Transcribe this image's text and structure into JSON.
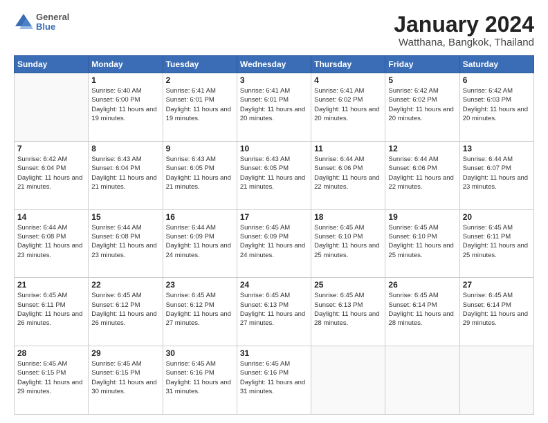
{
  "logo": {
    "general": "General",
    "blue": "Blue"
  },
  "title": "January 2024",
  "subtitle": "Watthana, Bangkok, Thailand",
  "days_of_week": [
    "Sunday",
    "Monday",
    "Tuesday",
    "Wednesday",
    "Thursday",
    "Friday",
    "Saturday"
  ],
  "weeks": [
    [
      {
        "day": "",
        "sunrise": "",
        "sunset": "",
        "daylight": "",
        "empty": true
      },
      {
        "day": "1",
        "sunrise": "Sunrise: 6:40 AM",
        "sunset": "Sunset: 6:00 PM",
        "daylight": "Daylight: 11 hours and 19 minutes."
      },
      {
        "day": "2",
        "sunrise": "Sunrise: 6:41 AM",
        "sunset": "Sunset: 6:01 PM",
        "daylight": "Daylight: 11 hours and 19 minutes."
      },
      {
        "day": "3",
        "sunrise": "Sunrise: 6:41 AM",
        "sunset": "Sunset: 6:01 PM",
        "daylight": "Daylight: 11 hours and 20 minutes."
      },
      {
        "day": "4",
        "sunrise": "Sunrise: 6:41 AM",
        "sunset": "Sunset: 6:02 PM",
        "daylight": "Daylight: 11 hours and 20 minutes."
      },
      {
        "day": "5",
        "sunrise": "Sunrise: 6:42 AM",
        "sunset": "Sunset: 6:02 PM",
        "daylight": "Daylight: 11 hours and 20 minutes."
      },
      {
        "day": "6",
        "sunrise": "Sunrise: 6:42 AM",
        "sunset": "Sunset: 6:03 PM",
        "daylight": "Daylight: 11 hours and 20 minutes."
      }
    ],
    [
      {
        "day": "7",
        "sunrise": "Sunrise: 6:42 AM",
        "sunset": "Sunset: 6:04 PM",
        "daylight": "Daylight: 11 hours and 21 minutes."
      },
      {
        "day": "8",
        "sunrise": "Sunrise: 6:43 AM",
        "sunset": "Sunset: 6:04 PM",
        "daylight": "Daylight: 11 hours and 21 minutes."
      },
      {
        "day": "9",
        "sunrise": "Sunrise: 6:43 AM",
        "sunset": "Sunset: 6:05 PM",
        "daylight": "Daylight: 11 hours and 21 minutes."
      },
      {
        "day": "10",
        "sunrise": "Sunrise: 6:43 AM",
        "sunset": "Sunset: 6:05 PM",
        "daylight": "Daylight: 11 hours and 21 minutes."
      },
      {
        "day": "11",
        "sunrise": "Sunrise: 6:44 AM",
        "sunset": "Sunset: 6:06 PM",
        "daylight": "Daylight: 11 hours and 22 minutes."
      },
      {
        "day": "12",
        "sunrise": "Sunrise: 6:44 AM",
        "sunset": "Sunset: 6:06 PM",
        "daylight": "Daylight: 11 hours and 22 minutes."
      },
      {
        "day": "13",
        "sunrise": "Sunrise: 6:44 AM",
        "sunset": "Sunset: 6:07 PM",
        "daylight": "Daylight: 11 hours and 23 minutes."
      }
    ],
    [
      {
        "day": "14",
        "sunrise": "Sunrise: 6:44 AM",
        "sunset": "Sunset: 6:08 PM",
        "daylight": "Daylight: 11 hours and 23 minutes."
      },
      {
        "day": "15",
        "sunrise": "Sunrise: 6:44 AM",
        "sunset": "Sunset: 6:08 PM",
        "daylight": "Daylight: 11 hours and 23 minutes."
      },
      {
        "day": "16",
        "sunrise": "Sunrise: 6:44 AM",
        "sunset": "Sunset: 6:09 PM",
        "daylight": "Daylight: 11 hours and 24 minutes."
      },
      {
        "day": "17",
        "sunrise": "Sunrise: 6:45 AM",
        "sunset": "Sunset: 6:09 PM",
        "daylight": "Daylight: 11 hours and 24 minutes."
      },
      {
        "day": "18",
        "sunrise": "Sunrise: 6:45 AM",
        "sunset": "Sunset: 6:10 PM",
        "daylight": "Daylight: 11 hours and 25 minutes."
      },
      {
        "day": "19",
        "sunrise": "Sunrise: 6:45 AM",
        "sunset": "Sunset: 6:10 PM",
        "daylight": "Daylight: 11 hours and 25 minutes."
      },
      {
        "day": "20",
        "sunrise": "Sunrise: 6:45 AM",
        "sunset": "Sunset: 6:11 PM",
        "daylight": "Daylight: 11 hours and 25 minutes."
      }
    ],
    [
      {
        "day": "21",
        "sunrise": "Sunrise: 6:45 AM",
        "sunset": "Sunset: 6:11 PM",
        "daylight": "Daylight: 11 hours and 26 minutes."
      },
      {
        "day": "22",
        "sunrise": "Sunrise: 6:45 AM",
        "sunset": "Sunset: 6:12 PM",
        "daylight": "Daylight: 11 hours and 26 minutes."
      },
      {
        "day": "23",
        "sunrise": "Sunrise: 6:45 AM",
        "sunset": "Sunset: 6:12 PM",
        "daylight": "Daylight: 11 hours and 27 minutes."
      },
      {
        "day": "24",
        "sunrise": "Sunrise: 6:45 AM",
        "sunset": "Sunset: 6:13 PM",
        "daylight": "Daylight: 11 hours and 27 minutes."
      },
      {
        "day": "25",
        "sunrise": "Sunrise: 6:45 AM",
        "sunset": "Sunset: 6:13 PM",
        "daylight": "Daylight: 11 hours and 28 minutes."
      },
      {
        "day": "26",
        "sunrise": "Sunrise: 6:45 AM",
        "sunset": "Sunset: 6:14 PM",
        "daylight": "Daylight: 11 hours and 28 minutes."
      },
      {
        "day": "27",
        "sunrise": "Sunrise: 6:45 AM",
        "sunset": "Sunset: 6:14 PM",
        "daylight": "Daylight: 11 hours and 29 minutes."
      }
    ],
    [
      {
        "day": "28",
        "sunrise": "Sunrise: 6:45 AM",
        "sunset": "Sunset: 6:15 PM",
        "daylight": "Daylight: 11 hours and 29 minutes."
      },
      {
        "day": "29",
        "sunrise": "Sunrise: 6:45 AM",
        "sunset": "Sunset: 6:15 PM",
        "daylight": "Daylight: 11 hours and 30 minutes."
      },
      {
        "day": "30",
        "sunrise": "Sunrise: 6:45 AM",
        "sunset": "Sunset: 6:16 PM",
        "daylight": "Daylight: 11 hours and 31 minutes."
      },
      {
        "day": "31",
        "sunrise": "Sunrise: 6:45 AM",
        "sunset": "Sunset: 6:16 PM",
        "daylight": "Daylight: 11 hours and 31 minutes."
      },
      {
        "day": "",
        "sunrise": "",
        "sunset": "",
        "daylight": "",
        "empty": true
      },
      {
        "day": "",
        "sunrise": "",
        "sunset": "",
        "daylight": "",
        "empty": true
      },
      {
        "day": "",
        "sunrise": "",
        "sunset": "",
        "daylight": "",
        "empty": true
      }
    ]
  ]
}
